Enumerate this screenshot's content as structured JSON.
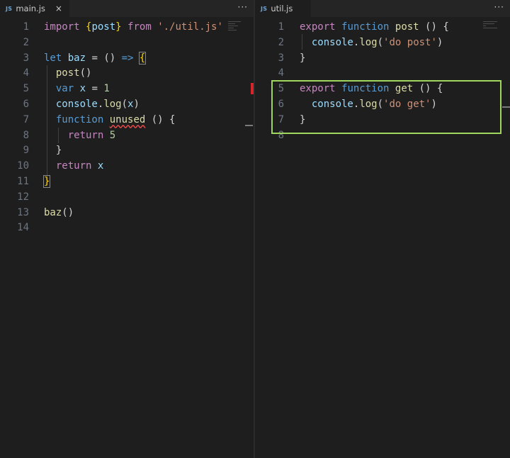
{
  "left_pane": {
    "tab": {
      "icon_text": "JS",
      "filename": "main.js",
      "close_glyph": "×"
    },
    "more_glyph": "···",
    "lines": [
      {
        "n": "1",
        "tokens": [
          [
            "kw",
            "import"
          ],
          [
            "pun",
            " "
          ],
          [
            "ob",
            "{"
          ],
          [
            "var",
            "post"
          ],
          [
            "ob",
            "}"
          ],
          [
            "pun",
            " "
          ],
          [
            "kw",
            "from"
          ],
          [
            "pun",
            " "
          ],
          [
            "str",
            "'./util.js'"
          ]
        ]
      },
      {
        "n": "2",
        "tokens": []
      },
      {
        "n": "3",
        "tokens": [
          [
            "st",
            "let"
          ],
          [
            "pun",
            " "
          ],
          [
            "var",
            "baz"
          ],
          [
            "pun",
            " = () "
          ],
          [
            "st",
            "=>"
          ],
          [
            "pun",
            " "
          ],
          [
            "ob-box",
            "{"
          ]
        ]
      },
      {
        "n": "4",
        "tokens": [
          [
            "pun",
            "  "
          ],
          [
            "fn",
            "post"
          ],
          [
            "pun",
            "()"
          ]
        ]
      },
      {
        "n": "5",
        "tokens": [
          [
            "pun",
            "  "
          ],
          [
            "st",
            "var"
          ],
          [
            "pun",
            " "
          ],
          [
            "var",
            "x"
          ],
          [
            "pun",
            " = "
          ],
          [
            "num",
            "1"
          ]
        ]
      },
      {
        "n": "6",
        "tokens": [
          [
            "pun",
            "  "
          ],
          [
            "var",
            "console"
          ],
          [
            "pun",
            "."
          ],
          [
            "fn",
            "log"
          ],
          [
            "pun",
            "("
          ],
          [
            "var",
            "x"
          ],
          [
            "pun",
            ")"
          ]
        ]
      },
      {
        "n": "7",
        "tokens": [
          [
            "pun",
            "  "
          ],
          [
            "st",
            "function"
          ],
          [
            "pun",
            " "
          ],
          [
            "fn-squig",
            "unused"
          ],
          [
            "pun",
            " () {"
          ]
        ]
      },
      {
        "n": "8",
        "tokens": [
          [
            "pun",
            "    "
          ],
          [
            "kw",
            "return"
          ],
          [
            "pun",
            " "
          ],
          [
            "num",
            "5"
          ]
        ]
      },
      {
        "n": "9",
        "tokens": [
          [
            "pun",
            "  }"
          ]
        ]
      },
      {
        "n": "10",
        "tokens": [
          [
            "pun",
            "  "
          ],
          [
            "kw",
            "return"
          ],
          [
            "pun",
            " "
          ],
          [
            "var",
            "x"
          ]
        ]
      },
      {
        "n": "11",
        "tokens": [
          [
            "ob-box",
            "}"
          ]
        ]
      },
      {
        "n": "12",
        "tokens": []
      },
      {
        "n": "13",
        "tokens": [
          [
            "fn",
            "baz"
          ],
          [
            "pun",
            "()"
          ]
        ]
      },
      {
        "n": "14",
        "tokens": []
      }
    ]
  },
  "right_pane": {
    "tab": {
      "icon_text": "JS",
      "filename": "util.js"
    },
    "more_glyph": "···",
    "lines": [
      {
        "n": "1",
        "tokens": [
          [
            "kw",
            "export"
          ],
          [
            "pun",
            " "
          ],
          [
            "st",
            "function"
          ],
          [
            "pun",
            " "
          ],
          [
            "fn",
            "post"
          ],
          [
            "pun",
            " () {"
          ]
        ]
      },
      {
        "n": "2",
        "tokens": [
          [
            "pun",
            "  "
          ],
          [
            "var",
            "console"
          ],
          [
            "pun",
            "."
          ],
          [
            "fn",
            "log"
          ],
          [
            "pun",
            "("
          ],
          [
            "str",
            "'do post'"
          ],
          [
            "pun",
            ")"
          ]
        ]
      },
      {
        "n": "3",
        "tokens": [
          [
            "pun",
            "}"
          ]
        ]
      },
      {
        "n": "4",
        "tokens": []
      },
      {
        "n": "5",
        "tokens": [
          [
            "kw",
            "export"
          ],
          [
            "pun",
            " "
          ],
          [
            "st",
            "function"
          ],
          [
            "pun",
            " "
          ],
          [
            "fn",
            "get"
          ],
          [
            "pun",
            " () {"
          ]
        ]
      },
      {
        "n": "6",
        "tokens": [
          [
            "pun",
            "  "
          ],
          [
            "var",
            "console"
          ],
          [
            "pun",
            "."
          ],
          [
            "fn",
            "log"
          ],
          [
            "pun",
            "("
          ],
          [
            "str",
            "'do get'"
          ],
          [
            "pun",
            ")"
          ]
        ]
      },
      {
        "n": "7",
        "tokens": [
          [
            "pun",
            "}"
          ]
        ]
      },
      {
        "n": "8",
        "tokens": []
      }
    ]
  },
  "colors": {
    "background": "#1e1e1e",
    "keyword": "#c586c0",
    "storage": "#569cd6",
    "function": "#dcdcaa",
    "variable": "#9cdcfe",
    "string": "#ce9178",
    "number": "#b5cea8",
    "highlight_box": "#9fd65c",
    "error_marker": "#d9242b"
  }
}
